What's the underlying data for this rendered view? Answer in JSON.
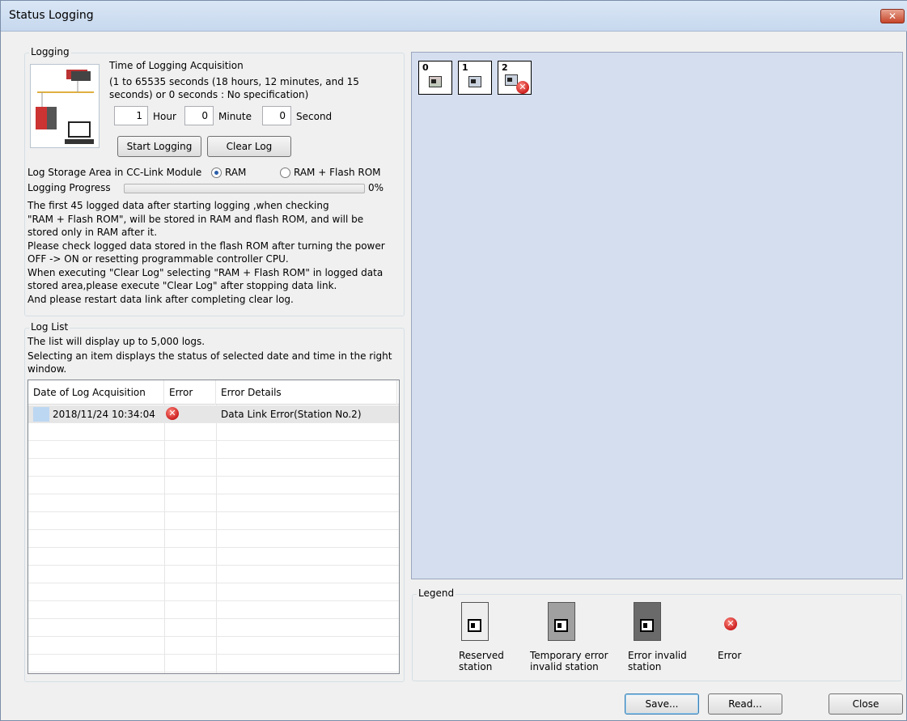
{
  "window": {
    "title": "Status Logging",
    "close_glyph": "✕"
  },
  "logging": {
    "group_label": "Logging",
    "time_label": "Time of Logging Acquisition",
    "range_line1": "(1 to 65535 seconds (18 hours, 12 minutes, and 15",
    "range_line2": "seconds) or 0 seconds : No specification)",
    "hour_value": "1",
    "hour_label": "Hour",
    "minute_value": "0",
    "minute_label": "Minute",
    "second_value": "0",
    "second_label": "Second",
    "start_button": "Start Logging",
    "clear_button": "Clear Log",
    "storage_label": "Log Storage Area in CC-Link Module",
    "storage_options": [
      "RAM",
      "RAM + Flash ROM"
    ],
    "storage_selected": "RAM",
    "progress_label": "Logging Progress",
    "progress_value": 0,
    "progress_text": "0%",
    "notes": [
      "The first 45 logged data after starting logging ,when checking",
      "\"RAM + Flash ROM\", will be stored in RAM and flash ROM, and will be",
      "stored only in RAM after it.",
      "Please check logged data stored in the flash ROM after turning the power",
      "OFF -> ON or resetting  programmable controller CPU.",
      "When executing \"Clear Log\" selecting \"RAM + Flash ROM\" in logged data",
      "stored area,please execute \"Clear Log\" after stopping data link.",
      "And please restart data link after completing clear log."
    ]
  },
  "log_list": {
    "group_label": "Log List",
    "info_line1": "The list will display up to 5,000 logs.",
    "info_line2": "Selecting an item displays the status of selected date and time in the right",
    "info_line3": "window.",
    "columns": [
      "Date of Log Acquisition",
      "Error",
      "Error Details"
    ],
    "rows": [
      {
        "date": "2018/11/24 10:34:04",
        "error": true,
        "details": "Data Link Error(Station No.2)"
      }
    ]
  },
  "stations": [
    {
      "number": "0",
      "error": false
    },
    {
      "number": "1",
      "error": false
    },
    {
      "number": "2",
      "error": true
    }
  ],
  "legend": {
    "group_label": "Legend",
    "items": [
      {
        "line1": "Reserved",
        "line2": "station",
        "color": "#eeeeee"
      },
      {
        "line1": "Temporary error",
        "line2": "invalid station",
        "color": "#a0a0a0"
      },
      {
        "line1": "Error invalid",
        "line2": "station",
        "color": "#6a6a6a"
      },
      {
        "line1": "Error",
        "line2": "",
        "color": ""
      }
    ],
    "error_glyph": "✕"
  },
  "buttons": {
    "save": "Save...",
    "read": "Read...",
    "close": "Close"
  },
  "colors": {
    "error_red": "#cc1f1f",
    "stage_bg": "#d5deef"
  }
}
